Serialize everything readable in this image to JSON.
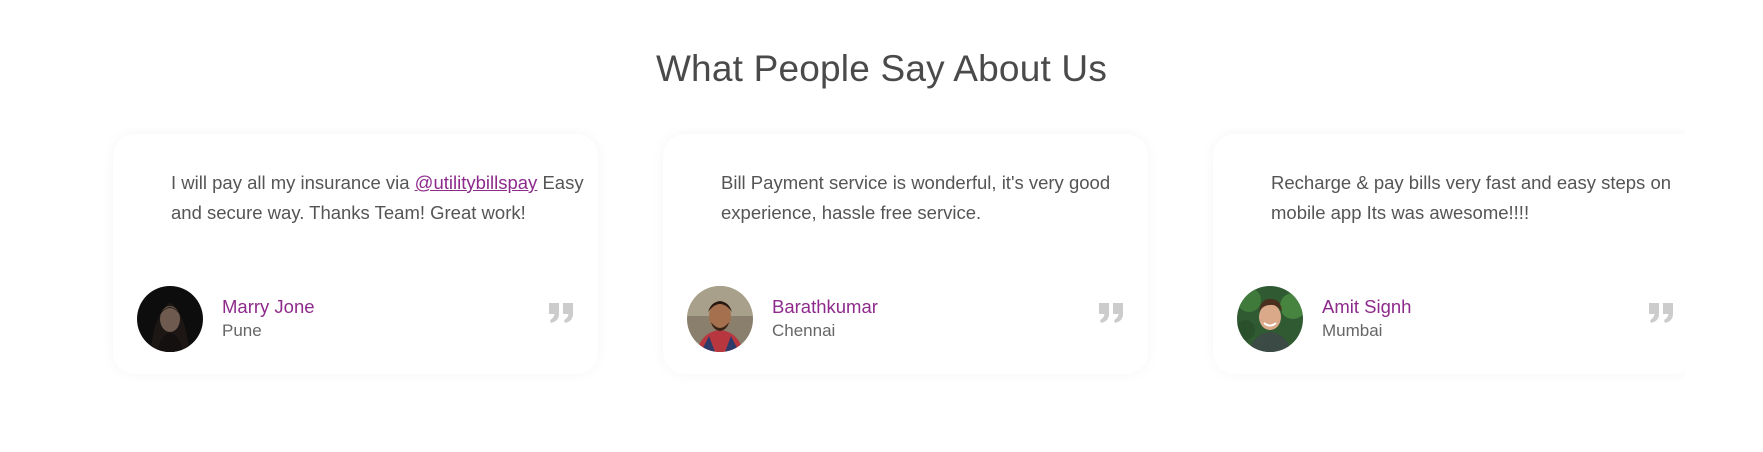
{
  "section": {
    "title": "What People Say About Us"
  },
  "testimonials": [
    {
      "text_before_link": "I will pay all my insurance via ",
      "link": "@utilitybillspay",
      "text_after_link": " Easy and secure way. Thanks Team! Great work!",
      "name": "Marry Jone",
      "city": "Pune"
    },
    {
      "text": "Bill Payment service is wonderful, it's very good experience, hassle free service.",
      "name": "Barathkumar",
      "city": "Chennai"
    },
    {
      "text": "Recharge & pay bills very fast and easy steps on mobile app Its was awesome!!!!",
      "name": "Amit Signh",
      "city": "Mumbai"
    }
  ],
  "icons": {
    "quote": "quote-icon",
    "avatar": "avatar"
  },
  "colors": {
    "accent": "#8e2a8c",
    "title": "#4a4a4a",
    "body_text": "#555555",
    "quote_icon": "#cccccc"
  }
}
